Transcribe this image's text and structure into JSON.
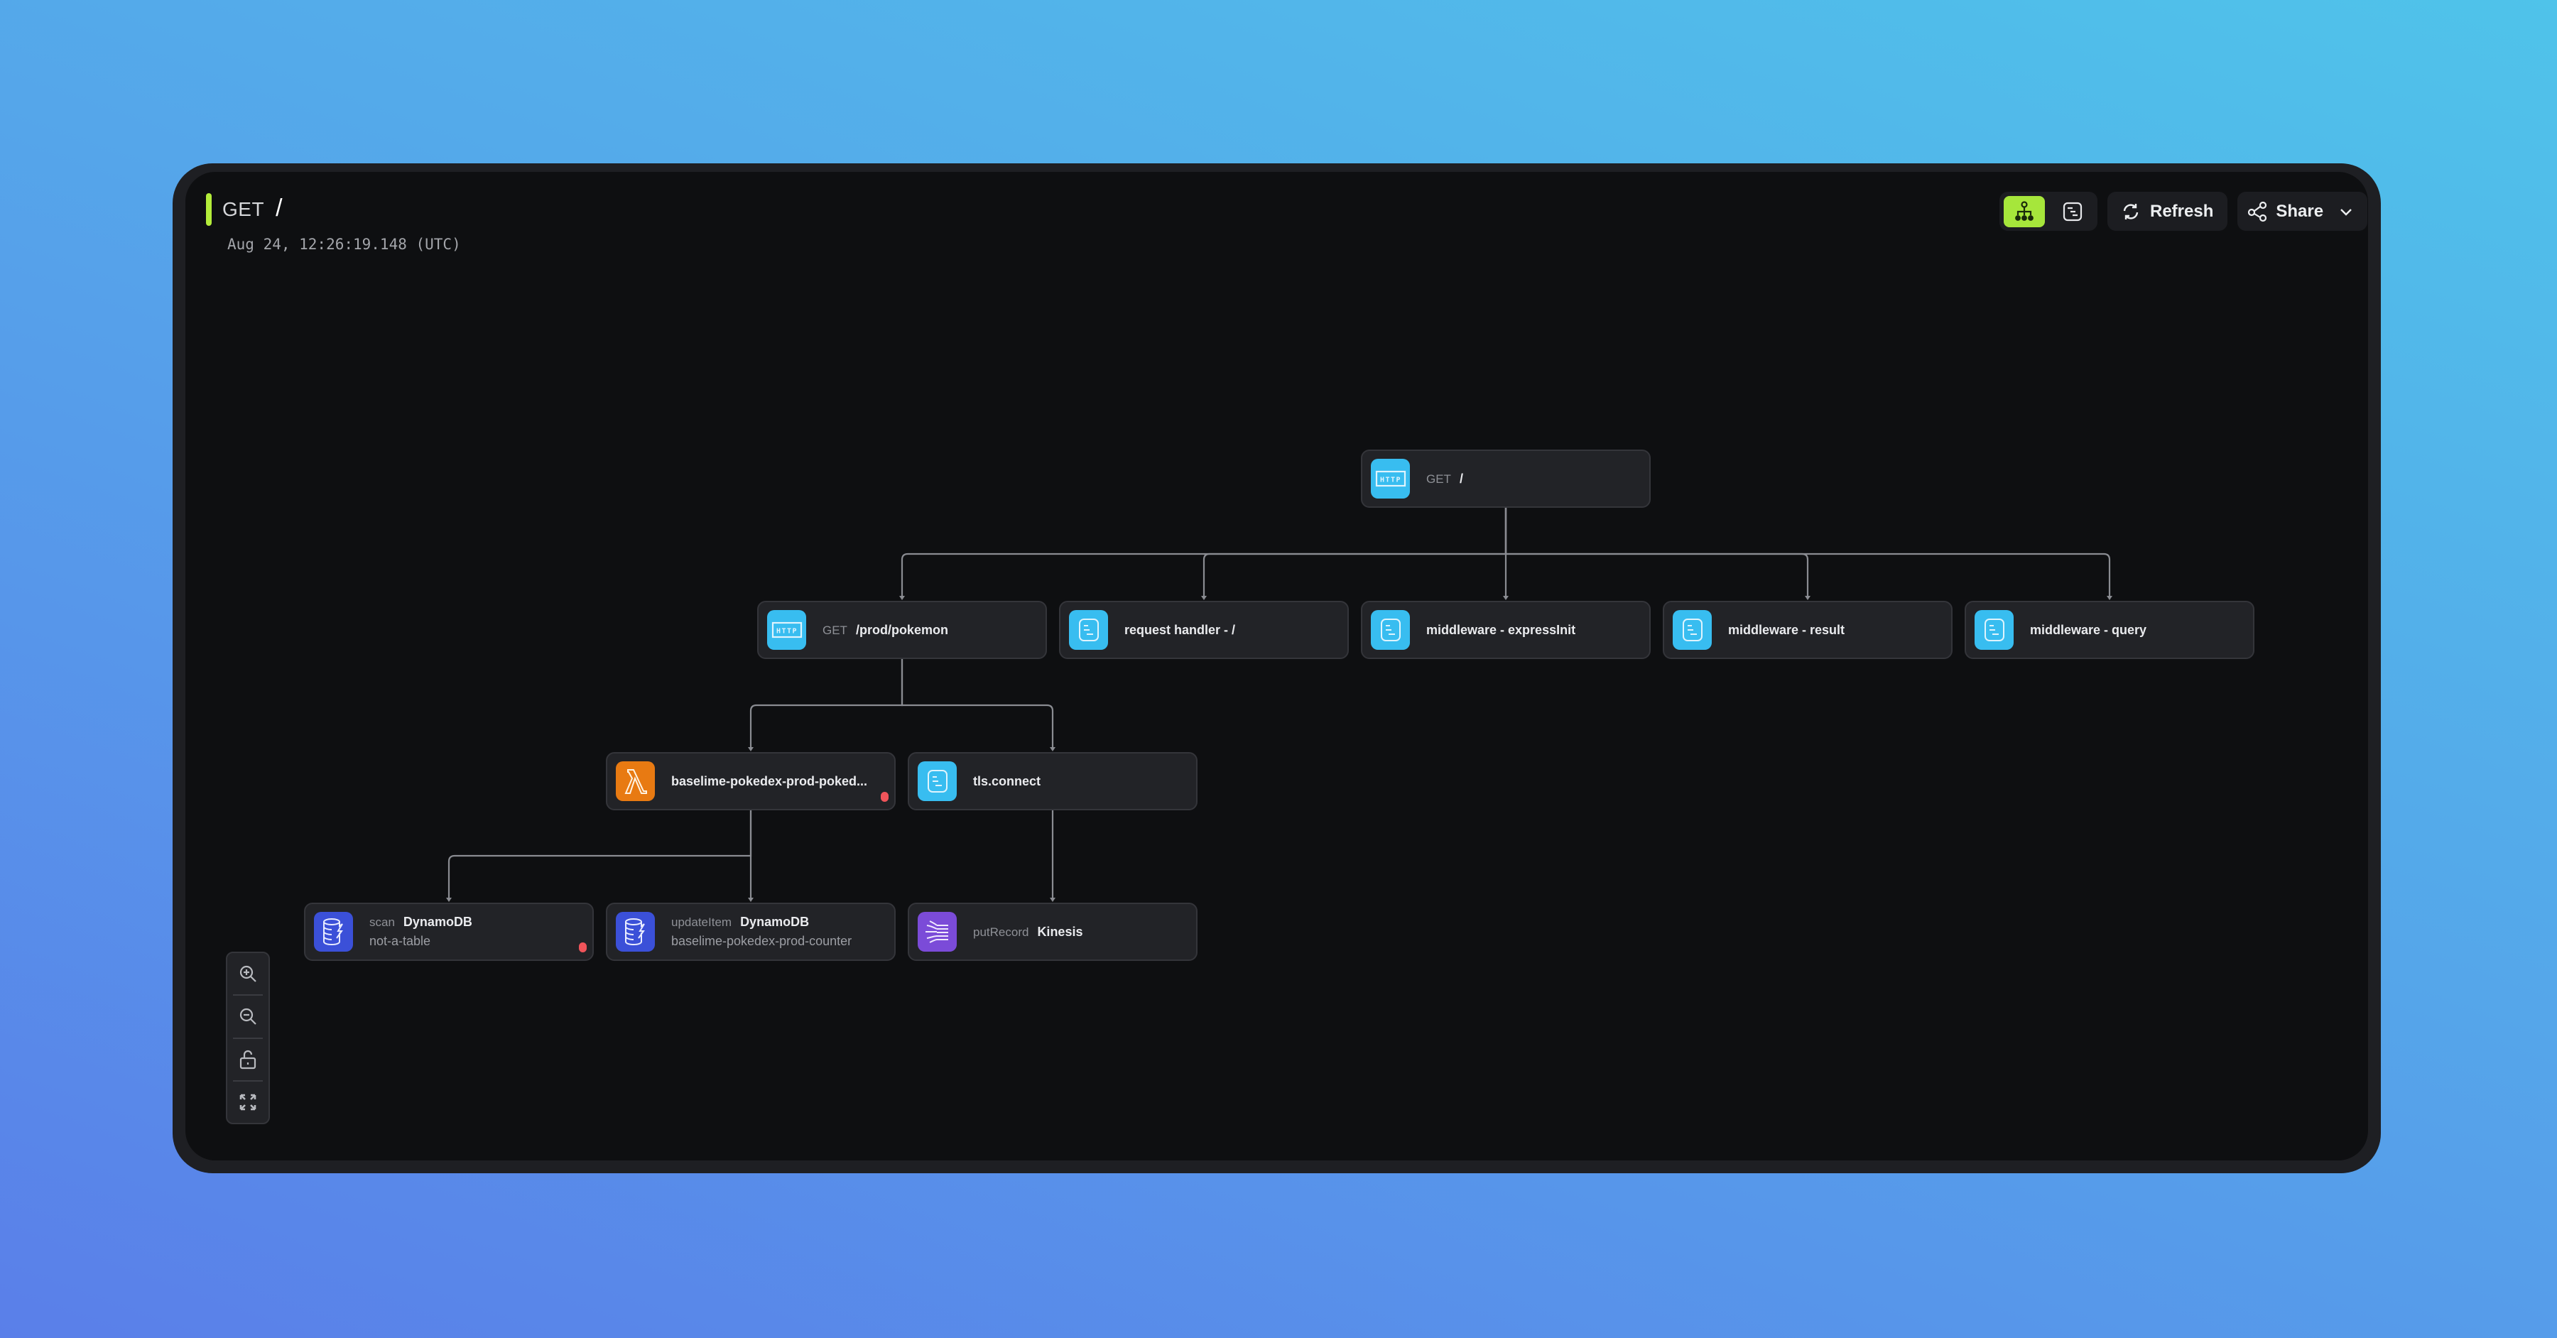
{
  "header": {
    "method": "GET",
    "path": "/",
    "timestamp": "Aug 24, 12:26:19.148 (UTC)"
  },
  "toolbar": {
    "view_toggle": [
      {
        "name": "tree-view",
        "icon": "hierarchy-icon",
        "active": true
      },
      {
        "name": "timeline-view",
        "icon": "timeline-icon",
        "active": false
      }
    ],
    "refresh_label": "Refresh",
    "share_label": "Share"
  },
  "colors": {
    "accent": "#a6e63b",
    "http_icon": "#38bdf0",
    "span_icon": "#38bdf0",
    "lambda_icon": "#e87a12",
    "dynamodb_icon": "#3b50d8",
    "kinesis_icon": "#7b4bd8",
    "error_dot": "#f0545a"
  },
  "trace": {
    "nodes": [
      {
        "id": "root",
        "type": "http",
        "op": "GET",
        "name": "/",
        "sub": null,
        "error": false
      },
      {
        "id": "prod-pokemon",
        "type": "http",
        "op": "GET",
        "name": "/prod/pokemon",
        "sub": null,
        "error": false
      },
      {
        "id": "request-handler",
        "type": "span",
        "op": null,
        "name": "request handler - /",
        "sub": null,
        "error": false
      },
      {
        "id": "mw-expressinit",
        "type": "span",
        "op": null,
        "name": "middleware - expressInit",
        "sub": null,
        "error": false
      },
      {
        "id": "mw-result",
        "type": "span",
        "op": null,
        "name": "middleware - result",
        "sub": null,
        "error": false
      },
      {
        "id": "mw-query",
        "type": "span",
        "op": null,
        "name": "middleware - query",
        "sub": null,
        "error": false
      },
      {
        "id": "lambda",
        "type": "lambda",
        "op": null,
        "name": "baselime-pokedex-prod-poked...",
        "sub": null,
        "error": true
      },
      {
        "id": "tls-connect",
        "type": "span",
        "op": null,
        "name": "tls.connect",
        "sub": null,
        "error": false
      },
      {
        "id": "scan",
        "type": "dynamodb",
        "op": "scan",
        "name": "DynamoDB",
        "sub": "not-a-table",
        "error": true
      },
      {
        "id": "updateitem",
        "type": "dynamodb",
        "op": "updateItem",
        "name": "DynamoDB",
        "sub": "baselime-pokedex-prod-counter",
        "error": false
      },
      {
        "id": "putrecord",
        "type": "kinesis",
        "op": "putRecord",
        "name": "Kinesis",
        "sub": null,
        "error": false
      }
    ],
    "edges": [
      [
        "root",
        "prod-pokemon"
      ],
      [
        "root",
        "request-handler"
      ],
      [
        "root",
        "mw-expressinit"
      ],
      [
        "root",
        "mw-result"
      ],
      [
        "root",
        "mw-query"
      ],
      [
        "prod-pokemon",
        "lambda"
      ],
      [
        "prod-pokemon",
        "tls-connect"
      ],
      [
        "lambda",
        "scan"
      ],
      [
        "lambda",
        "updateitem"
      ],
      [
        "tls-connect",
        "putrecord"
      ]
    ]
  },
  "zoom_controls": [
    {
      "name": "zoom-in",
      "icon": "zoom-in-icon"
    },
    {
      "name": "zoom-out",
      "icon": "zoom-out-icon"
    },
    {
      "name": "lock",
      "icon": "unlock-icon"
    },
    {
      "name": "fit-view",
      "icon": "fit-view-icon"
    }
  ]
}
